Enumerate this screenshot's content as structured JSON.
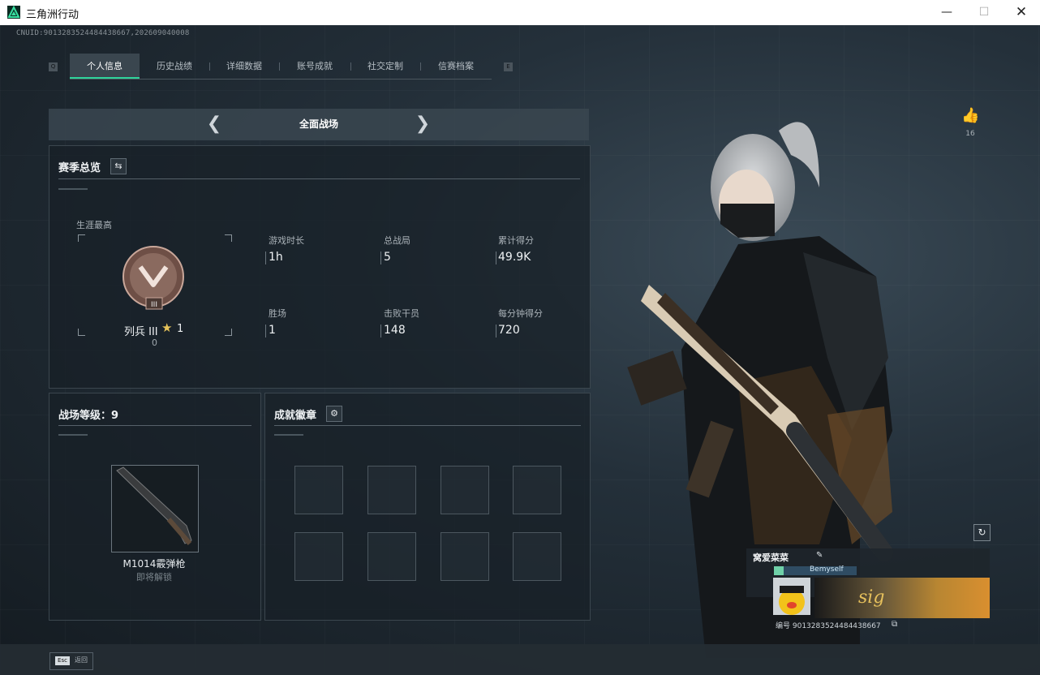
{
  "window": {
    "title": "三角洲行动",
    "min_icon": "minimize-icon",
    "max_icon": "maximize-icon",
    "close_icon": "close-icon"
  },
  "uid_text": "CNUID:9013283524484438667,202609040008",
  "tabs": [
    {
      "label": "个人信息",
      "active": true
    },
    {
      "label": "历史战绩",
      "active": false
    },
    {
      "label": "详细数据",
      "active": false
    },
    {
      "label": "账号成就",
      "active": false
    },
    {
      "label": "社交定制",
      "active": false
    },
    {
      "label": "信赛档案",
      "active": false
    }
  ],
  "tab_brackets": {
    "left": "Q",
    "right": "E"
  },
  "mode": {
    "label": "全面战场",
    "prev_icon": "chevron-left-icon",
    "next_icon": "chevron-right-icon"
  },
  "season": {
    "title": "赛季总览",
    "switch_icon": "swap-icon",
    "career_best_label": "生涯最高",
    "rank_name": "列兵 III",
    "rank_stars": "1",
    "rank_points": "0",
    "rank_numeral": "III",
    "stats": [
      {
        "label": "游戏时长",
        "value": "1h"
      },
      {
        "label": "总战局",
        "value": "5"
      },
      {
        "label": "累计得分",
        "value": "49.9K"
      },
      {
        "label": "胜场",
        "value": "1"
      },
      {
        "label": "击败干员",
        "value": "148"
      },
      {
        "label": "每分钟得分",
        "value": "720"
      }
    ]
  },
  "battlefield_level": {
    "title": "战场等级：9",
    "weapon_name": "M1014霰弹枪",
    "weapon_status": "即将解锁"
  },
  "achievements": {
    "title": "成就徽章",
    "settings_icon": "gear-icon",
    "slots": 8
  },
  "like": {
    "icon": "thumbs-up-icon",
    "count": "16"
  },
  "refresh_icon": "refresh-icon",
  "profile": {
    "name": "窝爱菜菜",
    "edit_icon": "pencil-icon",
    "tag": "Bemyself",
    "id_line": "编号 9013283524484438667",
    "copy_icon": "copy-icon"
  },
  "bottom": {
    "esc_key": "Esc",
    "esc_label": "返回"
  },
  "colors": {
    "accent": "#2ed39a",
    "background": "#1b242c"
  }
}
